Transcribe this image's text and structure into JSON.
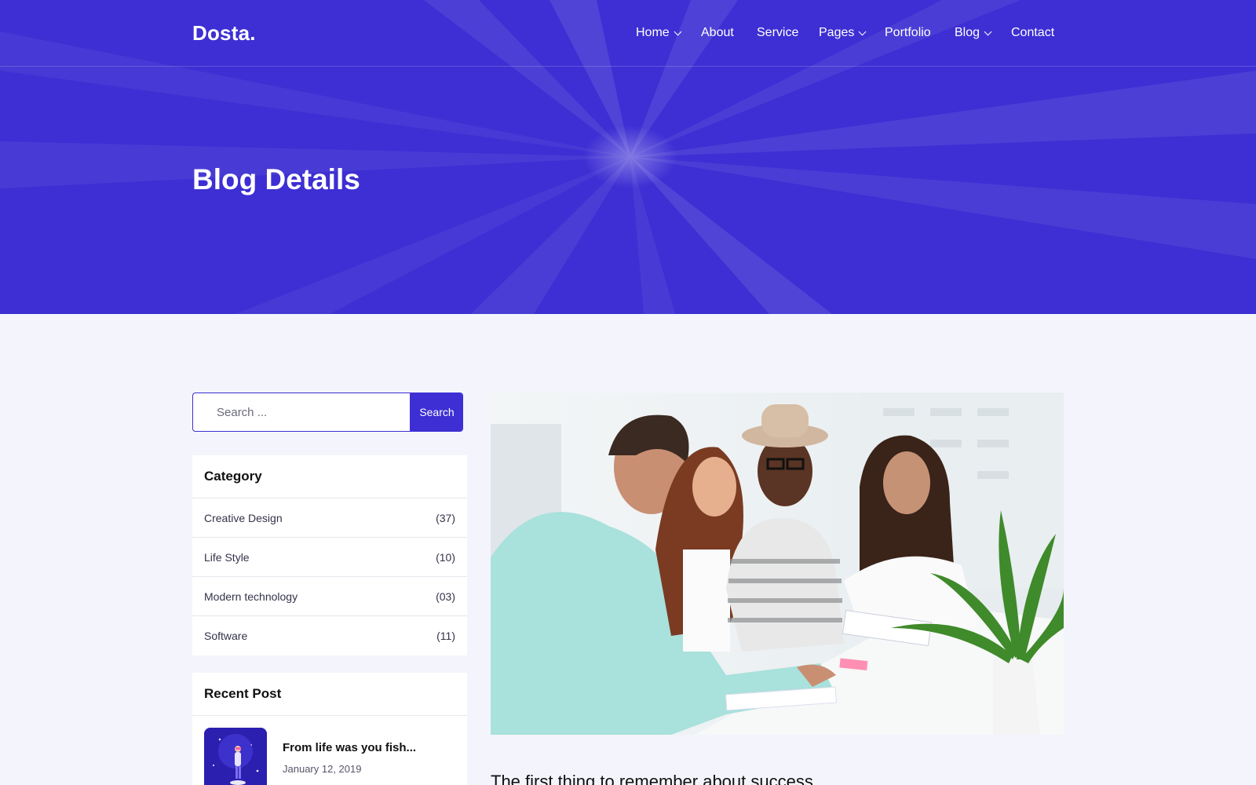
{
  "header": {
    "logo": "Dosta.",
    "nav": [
      {
        "label": "Home",
        "dropdown": true
      },
      {
        "label": "About",
        "dropdown": false
      },
      {
        "label": "Service",
        "dropdown": false
      },
      {
        "label": "Pages",
        "dropdown": true
      },
      {
        "label": "Portfolio",
        "dropdown": false
      },
      {
        "label": "Blog",
        "dropdown": true
      },
      {
        "label": "Contact",
        "dropdown": false
      }
    ]
  },
  "hero": {
    "title": "Blog Details"
  },
  "search": {
    "placeholder": "Search ...",
    "button_label": "Search"
  },
  "category": {
    "title": "Category",
    "items": [
      {
        "label": "Creative Design",
        "count": "(37)"
      },
      {
        "label": "Life Style",
        "count": "(10)"
      },
      {
        "label": "Modern technology",
        "count": "(03)"
      },
      {
        "label": "Software",
        "count": "(11)"
      }
    ]
  },
  "recent": {
    "title": "Recent Post",
    "items": [
      {
        "title": "From life was you fish...",
        "date": "January 12, 2019"
      }
    ]
  },
  "post": {
    "title": "The first thing to remember about success"
  },
  "colors": {
    "brand": "#3d2fd3",
    "page_bg": "#f4f5fc"
  },
  "icons": [
    "chevron-down-icon"
  ]
}
